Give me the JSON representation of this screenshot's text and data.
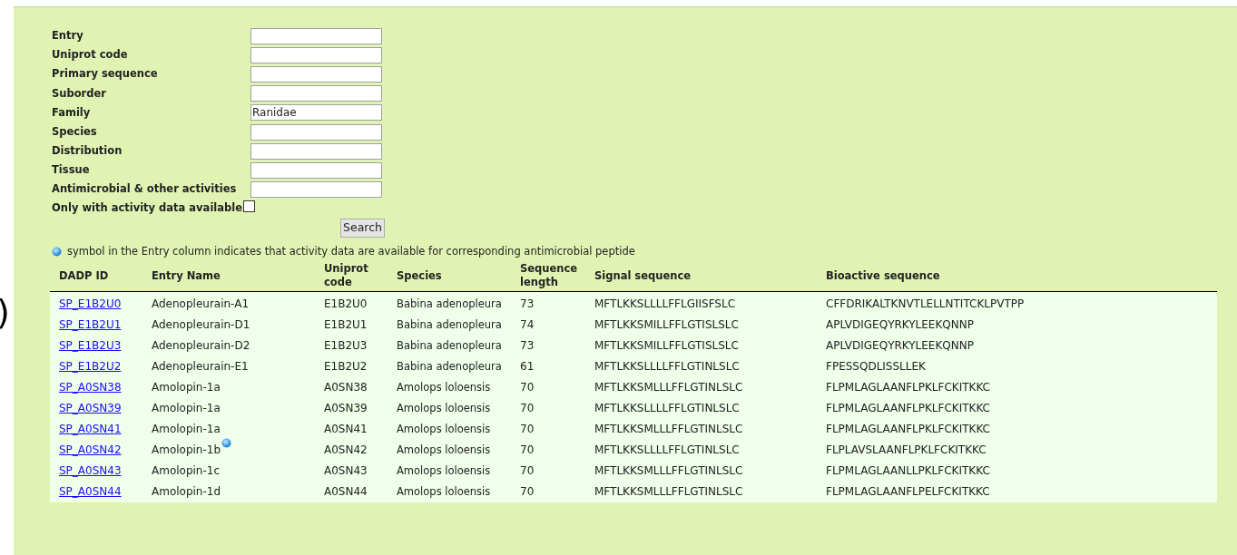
{
  "edge_fragment": ")",
  "search_form": {
    "fields": [
      {
        "label": "Entry"
      },
      {
        "label": "Uniprot code"
      },
      {
        "label": "Primary sequence"
      },
      {
        "label": "Suborder"
      },
      {
        "label": "Family",
        "value": "Ranidae"
      },
      {
        "label": "Species"
      },
      {
        "label": "Distribution"
      },
      {
        "label": "Tissue"
      },
      {
        "label": "Antimicrobial & other activities"
      }
    ],
    "checkbox": {
      "label": "Only with activity data available",
      "checked": false
    },
    "button": "Search"
  },
  "legend": "symbol in the Entry column indicates that activity data are available for corresponding antimicrobial peptide",
  "table": {
    "columns": [
      "DADP ID",
      "Entry Name",
      "Uniprot code",
      "Species",
      "Sequence length",
      "Signal sequence",
      "Bioactive sequence"
    ],
    "rows": [
      {
        "id": "SP_E1B2U0",
        "name": "Adenopleurain-A1",
        "activity": false,
        "uniprot": "E1B2U0",
        "species": "Babina adenopleura",
        "length": "73",
        "signal": "MFTLKKSLLLLFFLGIISFSLC",
        "bioactive": "CFFDRIKALTKNVTLELLNTITCKLPVTPP"
      },
      {
        "id": "SP_E1B2U1",
        "name": "Adenopleurain-D1",
        "activity": false,
        "uniprot": "E1B2U1",
        "species": "Babina adenopleura",
        "length": "74",
        "signal": "MFTLKKSMILLFFLGTISLSLC",
        "bioactive": "APLVDIGEQYRKYLEEKQNNP"
      },
      {
        "id": "SP_E1B2U3",
        "name": "Adenopleurain-D2",
        "activity": false,
        "uniprot": "E1B2U3",
        "species": "Babina adenopleura",
        "length": "73",
        "signal": "MFTLKKSMILLFFLGTISLSLC",
        "bioactive": "APLVDIGEQYRKYLEEKQNNP"
      },
      {
        "id": "SP_E1B2U2",
        "name": "Adenopleurain-E1",
        "activity": false,
        "uniprot": "E1B2U2",
        "species": "Babina adenopleura",
        "length": "61",
        "signal": "MFTLKKSLLLLFFLGTINLSLC",
        "bioactive": "FPESSQDLISSLLEK"
      },
      {
        "id": "SP_A0SN38",
        "name": "Amolopin-1a",
        "activity": false,
        "uniprot": "A0SN38",
        "species": "Amolops loloensis",
        "length": "70",
        "signal": "MFTLKKSMLLLFFLGTINLSLC",
        "bioactive": "FLPMLAGLAANFLPKLFCKITKKC"
      },
      {
        "id": "SP_A0SN39",
        "name": "Amolopin-1a",
        "activity": false,
        "uniprot": "A0SN39",
        "species": "Amolops loloensis",
        "length": "70",
        "signal": "MFTLKKSLLLLFFLGTINLSLC",
        "bioactive": "FLPMLAGLAANFLPKLFCKITKKC"
      },
      {
        "id": "SP_A0SN41",
        "name": "Amolopin-1a",
        "activity": false,
        "uniprot": "A0SN41",
        "species": "Amolops loloensis",
        "length": "70",
        "signal": "MFTLKKSMLLLFFLGTINLSLC",
        "bioactive": "FLPMLAGLAANFLPKLFCKITKKC"
      },
      {
        "id": "SP_A0SN42",
        "name": "Amolopin-1b",
        "activity": true,
        "uniprot": "A0SN42",
        "species": "Amolops loloensis",
        "length": "70",
        "signal": "MFTLKKSLLLLFFLGTINLSLC",
        "bioactive": "FLPLAVSLAANFLPKLFCKITKKC"
      },
      {
        "id": "SP_A0SN43",
        "name": "Amolopin-1c",
        "activity": false,
        "uniprot": "A0SN43",
        "species": "Amolops loloensis",
        "length": "70",
        "signal": "MFTLKKSMLLLFFLGTINLSLC",
        "bioactive": "FLPMLAGLAANLLPKLFCKITKKC"
      },
      {
        "id": "SP_A0SN44",
        "name": "Amolopin-1d",
        "activity": false,
        "uniprot": "A0SN44",
        "species": "Amolops loloensis",
        "length": "70",
        "signal": "MFTLKKSMLLLFFLGTINLSLC",
        "bioactive": "FLPMLAGLAANFLPELFCKITKKC"
      }
    ]
  }
}
